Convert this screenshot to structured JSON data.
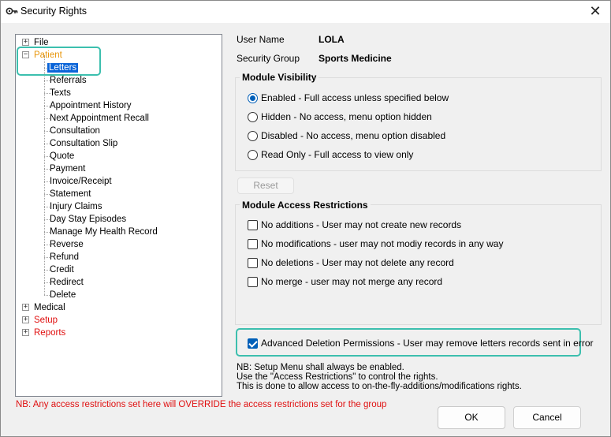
{
  "window": {
    "title": "Security Rights",
    "close_glyph": "✕"
  },
  "tree": {
    "items": [
      {
        "label": "File",
        "expander": "+"
      },
      {
        "label": "Patient",
        "expander": "−"
      },
      {
        "label": "Letters"
      },
      {
        "label": "Referrals"
      },
      {
        "label": "Texts"
      },
      {
        "label": "Appointment History"
      },
      {
        "label": "Next Appointment Recall"
      },
      {
        "label": "Consultation"
      },
      {
        "label": "Consultation Slip"
      },
      {
        "label": "Quote"
      },
      {
        "label": "Payment"
      },
      {
        "label": "Invoice/Receipt"
      },
      {
        "label": "Statement"
      },
      {
        "label": "Injury Claims"
      },
      {
        "label": "Day Stay Episodes"
      },
      {
        "label": "Manage My Health Record"
      },
      {
        "label": "Reverse"
      },
      {
        "label": "Refund"
      },
      {
        "label": "Credit"
      },
      {
        "label": "Redirect"
      },
      {
        "label": "Delete"
      },
      {
        "label": "Medical",
        "expander": "+"
      },
      {
        "label": "Setup",
        "expander": "+"
      },
      {
        "label": "Reports",
        "expander": "+"
      }
    ],
    "selected": "Letters"
  },
  "user": {
    "name_label": "User Name",
    "name_value": "LOLA",
    "group_label": "Security Group",
    "group_value": "Sports Medicine"
  },
  "visibility": {
    "title": "Module Visibility",
    "options": [
      {
        "label": "Enabled - Full access unless specified below",
        "selected": true
      },
      {
        "label": "Hidden - No access, menu option hidden",
        "selected": false
      },
      {
        "label": "Disabled - No access, menu option disabled",
        "selected": false
      },
      {
        "label": "Read Only - Full access to view only",
        "selected": false
      }
    ]
  },
  "reset_label": "Reset",
  "restrictions": {
    "title": "Module Access Restrictions",
    "options": [
      {
        "label": "No additions - User may not create new records",
        "checked": false
      },
      {
        "label": "No modifications - user may not modiy records in any way",
        "checked": false
      },
      {
        "label": "No deletions - User may not delete any record",
        "checked": false
      },
      {
        "label": "No merge - user may not merge any record",
        "checked": false
      }
    ]
  },
  "advanced": {
    "label": "Advanced Deletion Permissions - User may remove letters records sent in error",
    "checked": true
  },
  "notes": [
    "NB: Setup Menu shall always be enabled.",
    "Use the \"Access Restrictions\" to control the rights.",
    "This is done to allow access to on-the-fly-additions/modifications rights."
  ],
  "warning": "NB: Any access restrictions set here will OVERRIDE the access restrictions set for the group",
  "buttons": {
    "ok": "OK",
    "cancel": "Cancel"
  },
  "colors": {
    "accent": "#005fb8",
    "selection": "#0a64d8",
    "highlight": "#3cbfae",
    "warning": "#e01010",
    "patient": "#e8960a"
  }
}
